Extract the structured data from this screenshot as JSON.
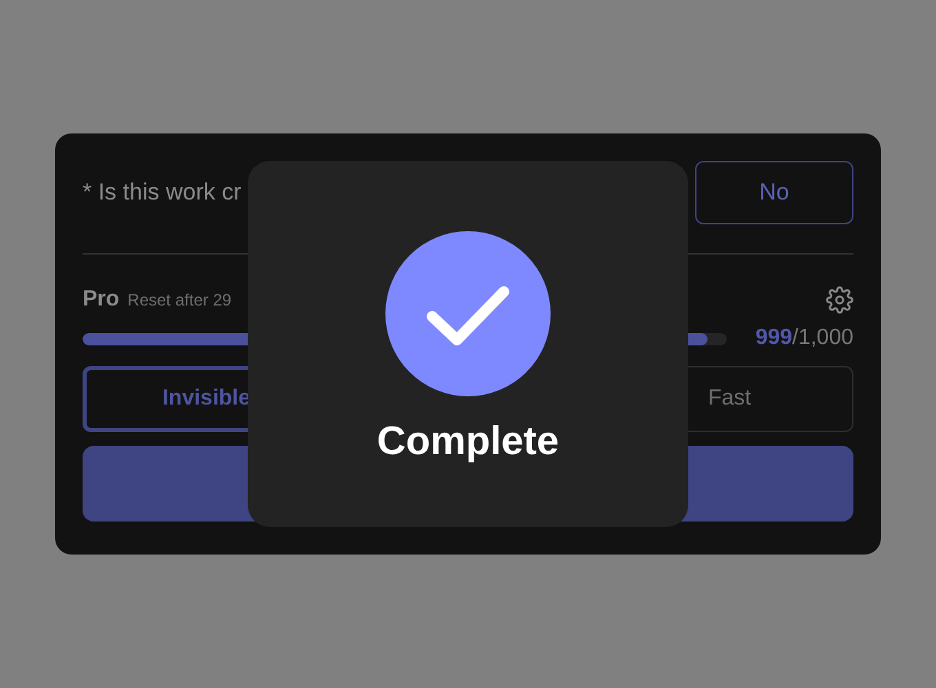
{
  "question": {
    "text": "* Is this work cr",
    "answer_button": "No"
  },
  "plan": {
    "name": "Pro",
    "reset_note": "Reset after 29",
    "usage": {
      "level": 0.97,
      "used": "999",
      "total": "/1,000"
    }
  },
  "modes": [
    {
      "label": "Invisible",
      "selected": true
    },
    {
      "label": "Fast",
      "selected": false
    }
  ],
  "dialog": {
    "title": "Complete"
  }
}
